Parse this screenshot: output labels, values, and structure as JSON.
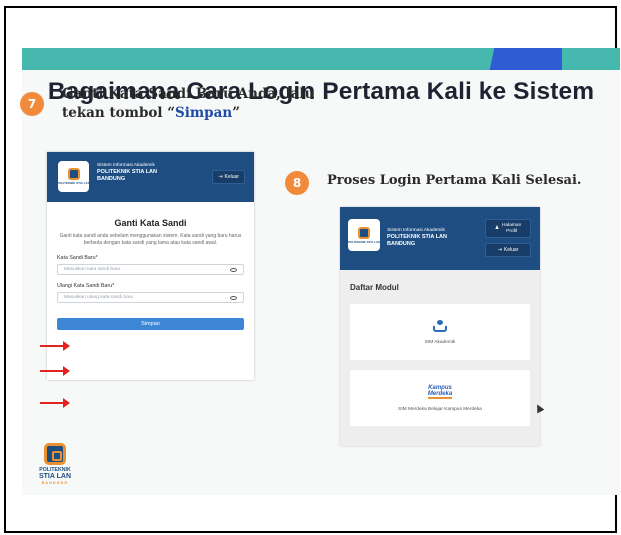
{
  "slide": {
    "title": "Bagaimana Cara Login Pertama Kali ke Sistem",
    "step7": {
      "number": "7",
      "text_line1": "Ganti Kata Sandi Baru Anda, lalu",
      "text_line2_prefix": "tekan tombol “",
      "text_keyword": "Simpan",
      "text_line2_suffix": "”"
    },
    "step8": {
      "number": "8",
      "text": "Proses Login Pertama Kali Selesai."
    }
  },
  "left_screen": {
    "header": {
      "system_label": "Sistem Informasi Akademik",
      "institution_line1": "POLITEKNIK STIA LAN",
      "institution_line2": "BANDUNG",
      "logout_label": "Keluar"
    },
    "form": {
      "title": "Ganti Kata Sandi",
      "description": "Ganti kata sandi anda sebelum menggunakan sistem. Kata sandi yang baru harus berbeda dengan kata sandi yang lama atau kata sandi awal.",
      "new_password_label": "Kata Sandi Baru*",
      "new_password_placeholder": "Masukkan kata sandi baru",
      "repeat_password_label": "Ulangi Kata Sandi Baru*",
      "repeat_password_placeholder": "Masukkan ulang kata sandi baru",
      "submit_label": "Simpan"
    }
  },
  "right_screen": {
    "header": {
      "system_label": "Sistem Informasi Akademik",
      "institution_line1": "POLITEKNIK STIA LAN",
      "institution_line2": "BANDUNG",
      "profile_label_line1": "Halaman",
      "profile_label_line2": "Profil",
      "logout_label": "Keluar"
    },
    "modules_title": "Daftar Modul",
    "modules": [
      {
        "label": "SIM Akademik"
      },
      {
        "label": "SIM Merdeka Belajar Kampus Merdeka",
        "logo_text_line1": "Kampus",
        "logo_text_line2": "Merdeka"
      }
    ]
  },
  "brand": {
    "line1": "POLITEKNIK",
    "line2": "STIA LAN",
    "line3": "BANDUNG"
  },
  "colors": {
    "teal_band": "#46b8ae",
    "blue_accent": "#2f5bd3",
    "step_badge": "#f18a3b",
    "header_navy": "#1e4d82",
    "save_button": "#3e86d6",
    "arrow_red": "#e2231f"
  }
}
